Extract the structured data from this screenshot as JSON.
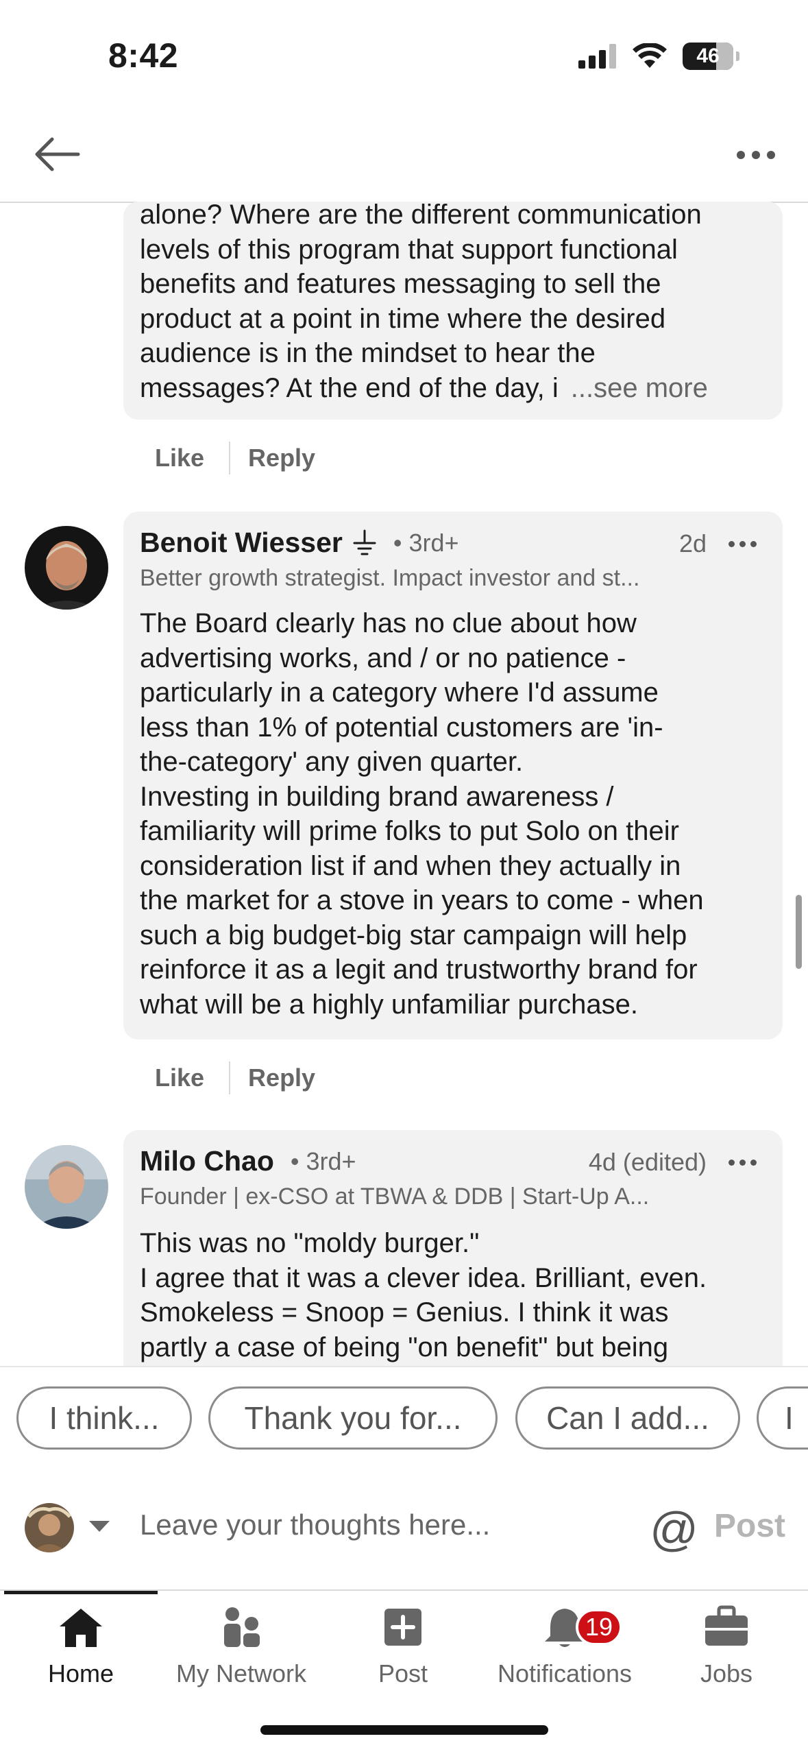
{
  "status_bar": {
    "time": "8:42",
    "battery": "46"
  },
  "comments": [
    {
      "text_lines": "alone? Where are the different communication\nlevels of this program that support functional\nbenefits and features messaging to sell the\nproduct at a point in time where the desired\naudience is in the mindset to hear the\nmessages? At the end of the day, i",
      "see_more": "...see more",
      "like": "Like",
      "reply": "Reply"
    },
    {
      "name": "Benoit Wiesser",
      "degree": "• 3rd+",
      "time": "2d",
      "headline": "Better growth strategist. Impact investor and st...",
      "text": "The Board clearly has no clue about how\nadvertising works, and / or no patience -\nparticularly in a category where I'd assume\nless than 1% of potential customers are 'in-\nthe-category' any given quarter.\nInvesting in building brand awareness /\nfamiliarity will prime folks to put Solo on their\nconsideration list if and when they actually in\nthe market for a stove in years to come - when\nsuch a big budget-big star campaign will help\nreinforce it as a legit and trustworthy brand for\nwhat will be a highly unfamiliar purchase.",
      "like": "Like",
      "reply": "Reply"
    },
    {
      "name": "Milo Chao",
      "degree": "• 3rd+",
      "time": "4d (edited)",
      "headline": "Founder | ex-CSO at TBWA & DDB | Start-Up A...",
      "text": "This was no \"moldy burger.\"\nI agree that it was a clever idea. Brilliant, even.\nSmokeless = Snoop = Genius. I think it was\npartly a case of being \"on benefit\" but being"
    }
  ],
  "suggestions": [
    "I think...",
    "Thank you for...",
    "Can I add...",
    "I"
  ],
  "composer": {
    "placeholder": "Leave your thoughts here...",
    "at": "@",
    "post": "Post"
  },
  "nav": [
    {
      "label": "Home",
      "icon": "home-icon"
    },
    {
      "label": "My Network",
      "icon": "network-icon"
    },
    {
      "label": "Post",
      "icon": "post-icon"
    },
    {
      "label": "Notifications",
      "icon": "bell-icon",
      "badge": "19"
    },
    {
      "label": "Jobs",
      "icon": "briefcase-icon"
    }
  ]
}
